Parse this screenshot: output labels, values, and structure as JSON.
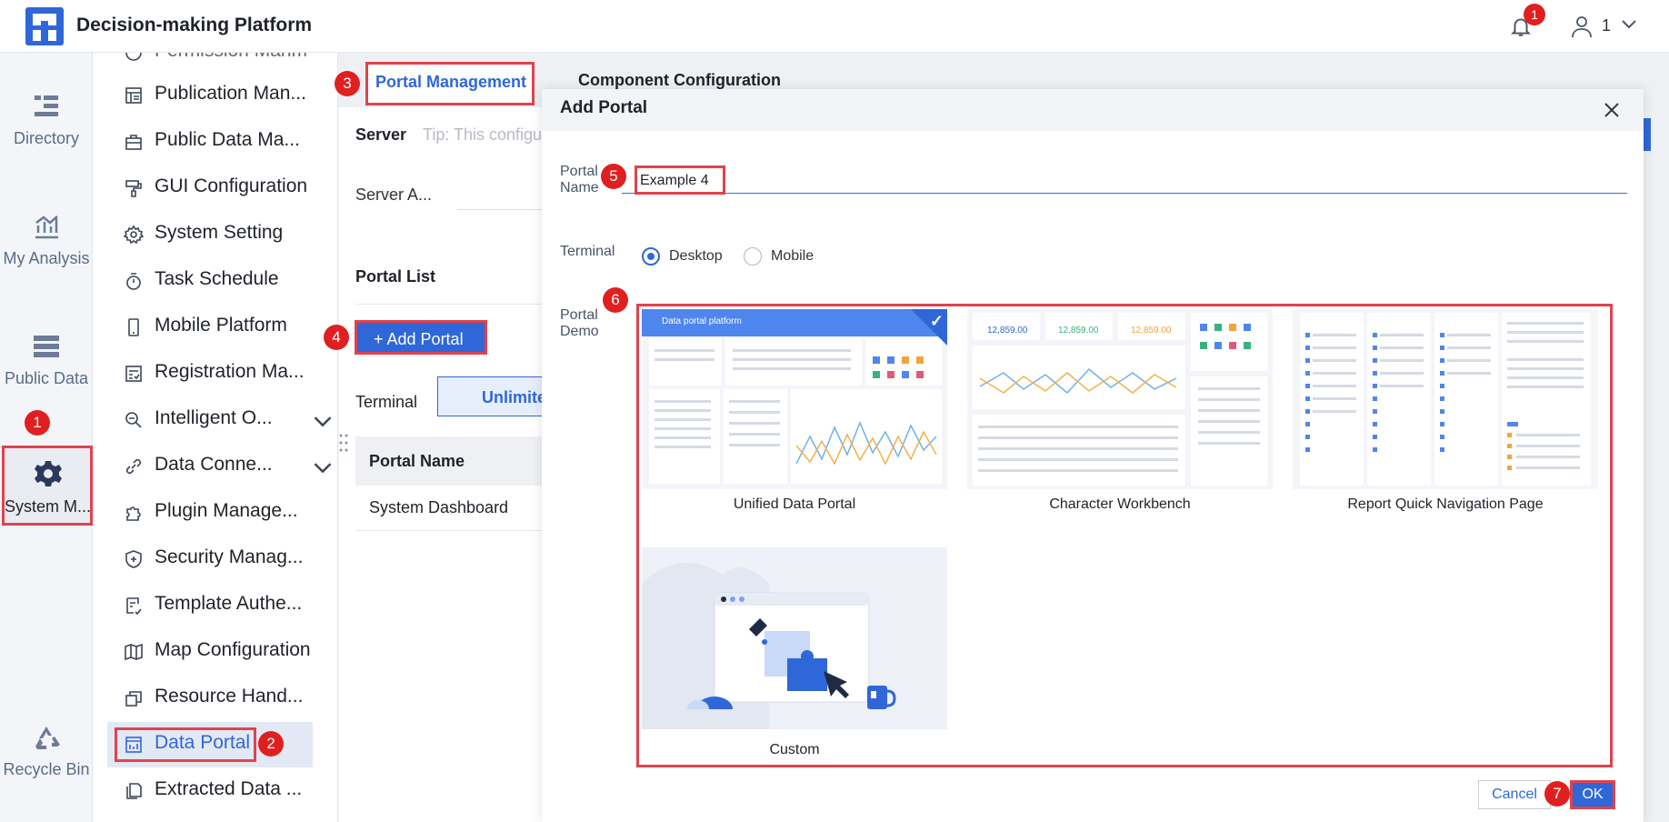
{
  "header": {
    "title": "Decision-making Platform",
    "notification_count": "1",
    "user_name": "1"
  },
  "rail": {
    "items": [
      {
        "label": "Directory",
        "icon": "directory-icon"
      },
      {
        "label": "My Analysis",
        "icon": "analysis-icon"
      },
      {
        "label": "Public Data",
        "icon": "public-data-icon"
      },
      {
        "label": "System M...",
        "icon": "system-management-icon"
      },
      {
        "label": "Recycle Bin",
        "icon": "recycle-bin-icon"
      }
    ]
  },
  "menu": {
    "partial_top": "Permission Manm",
    "items": [
      {
        "label": "Publication Man..."
      },
      {
        "label": "Public Data Ma..."
      },
      {
        "label": "GUI Configuration"
      },
      {
        "label": "System Setting"
      },
      {
        "label": "Task Schedule"
      },
      {
        "label": "Mobile Platform"
      },
      {
        "label": "Registration Ma..."
      },
      {
        "label": "Intelligent O..."
      },
      {
        "label": "Data Conne..."
      },
      {
        "label": "Plugin Manage..."
      },
      {
        "label": "Security Manag..."
      },
      {
        "label": "Template Authe..."
      },
      {
        "label": "Map Configuration"
      },
      {
        "label": "Resource Hand..."
      },
      {
        "label": "Data Portal"
      },
      {
        "label": "Extracted Data ..."
      }
    ]
  },
  "main": {
    "tabs": [
      "Portal Management",
      "Component Configuration"
    ],
    "server_label": "Server",
    "server_tip": "Tip: This configu",
    "server_address_label": "Server A...",
    "portal_list_label": "Portal List",
    "add_portal_label": "+ Add Portal",
    "terminal_label": "Terminal",
    "terminal_tab": "Unlimited",
    "table_header": "Portal Name",
    "table_rows": [
      "System Dashboard"
    ]
  },
  "modal": {
    "title": "Add Portal",
    "portal_name_label": "Portal Name",
    "portal_name_value": "Example 4",
    "terminal_label": "Terminal",
    "terminal_options": [
      "Desktop",
      "Mobile"
    ],
    "selected_terminal": "Desktop",
    "portal_demo_label": "Portal Demo",
    "demos": [
      "Unified Data Portal",
      "Character Workbench",
      "Report Quick Navigation Page",
      "Custom"
    ],
    "demo_thumb_header": "Data portal platform",
    "workbench_values": [
      "12,859.00",
      "12,859.00",
      "12,859.00"
    ],
    "cancel_label": "Cancel",
    "ok_label": "OK"
  },
  "markers": [
    "1",
    "2",
    "3",
    "4",
    "5",
    "6",
    "7"
  ],
  "colors": {
    "accent": "#2f67d8",
    "highlight": "#e0434d",
    "marker": "#e02020"
  }
}
